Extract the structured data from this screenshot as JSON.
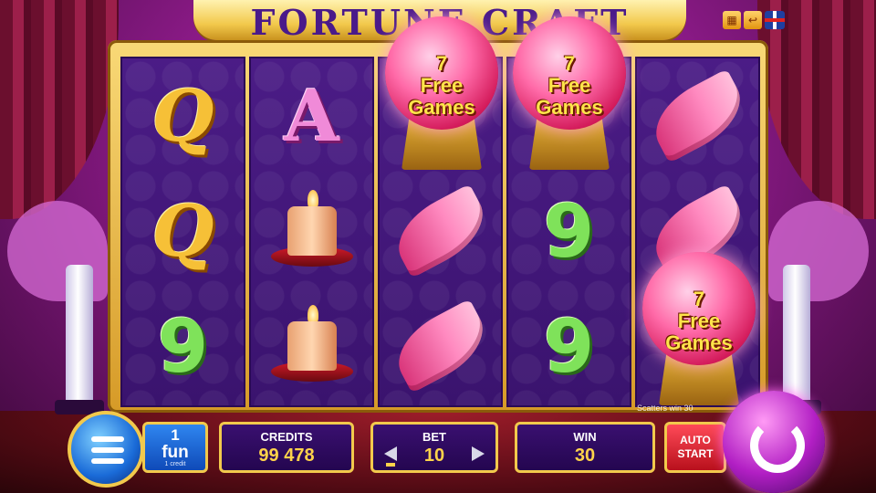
{
  "title": "FORTUNE CRAFT",
  "top_icons": [
    "paytable-icon",
    "exit-icon",
    "uk-flag-icon"
  ],
  "reels": [
    [
      "Q",
      "Q",
      "9"
    ],
    [
      "A",
      "candle",
      "candle"
    ],
    [
      "crystal-ball",
      "feather",
      "feather"
    ],
    [
      "crystal-ball",
      "9",
      "9"
    ],
    [
      "feather",
      "feather",
      "crystal-ball"
    ]
  ],
  "scatter_label": "7\nFree\nGames",
  "scatter_line1": "7",
  "scatter_line2": "Free",
  "scatter_line3": "Games",
  "scatter_win_text": "Scatters win 30",
  "panel": {
    "lines_value": "1",
    "fun_label": "fun",
    "credit_note": "1 credit",
    "credits_label": "CREDITS",
    "credits_value": "99 478",
    "bet_label": "BET",
    "bet_value": "10",
    "win_label": "WIN",
    "win_value": "30",
    "auto_line1": "AUTO",
    "auto_line2": "START"
  },
  "colors": {
    "accent_gold": "#f2c94c",
    "reel_bg": "#3a136e",
    "spin_purple": "#b21fc4"
  }
}
